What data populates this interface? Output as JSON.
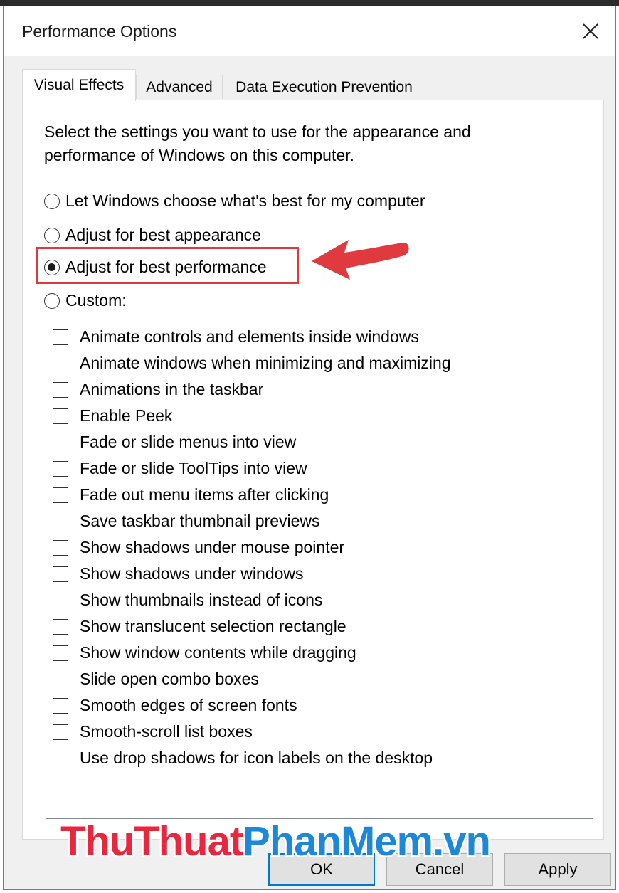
{
  "window": {
    "title": "Performance Options"
  },
  "tabs": [
    {
      "label": "Visual Effects",
      "active": true
    },
    {
      "label": "Advanced",
      "active": false
    },
    {
      "label": "Data Execution Prevention",
      "active": false
    }
  ],
  "description": "Select the settings you want to use for the appearance and performance of Windows on this computer.",
  "options": [
    {
      "label": "Let Windows choose what's best for my computer",
      "checked": false
    },
    {
      "label": "Adjust for best appearance",
      "checked": false
    },
    {
      "label": "Adjust for best performance",
      "checked": true
    },
    {
      "label": "Custom:",
      "checked": false
    }
  ],
  "effects": [
    "Animate controls and elements inside windows",
    "Animate windows when minimizing and maximizing",
    "Animations in the taskbar",
    "Enable Peek",
    "Fade or slide menus into view",
    "Fade or slide ToolTips into view",
    "Fade out menu items after clicking",
    "Save taskbar thumbnail previews",
    "Show shadows under mouse pointer",
    "Show shadows under windows",
    "Show thumbnails instead of icons",
    "Show translucent selection rectangle",
    "Show window contents while dragging",
    "Slide open combo boxes",
    "Smooth edges of screen fonts",
    "Smooth-scroll list boxes",
    "Use drop shadows for icon labels on the desktop"
  ],
  "buttons": {
    "ok": "OK",
    "cancel": "Cancel",
    "apply": "Apply"
  },
  "watermark": {
    "part1": "ThuThuat",
    "part2": "PhanMem",
    "part3": ".vn"
  },
  "colors": {
    "highlight": "#e0393e",
    "watermark_red": "#e8273f",
    "watermark_blue": "#1e88d8"
  }
}
